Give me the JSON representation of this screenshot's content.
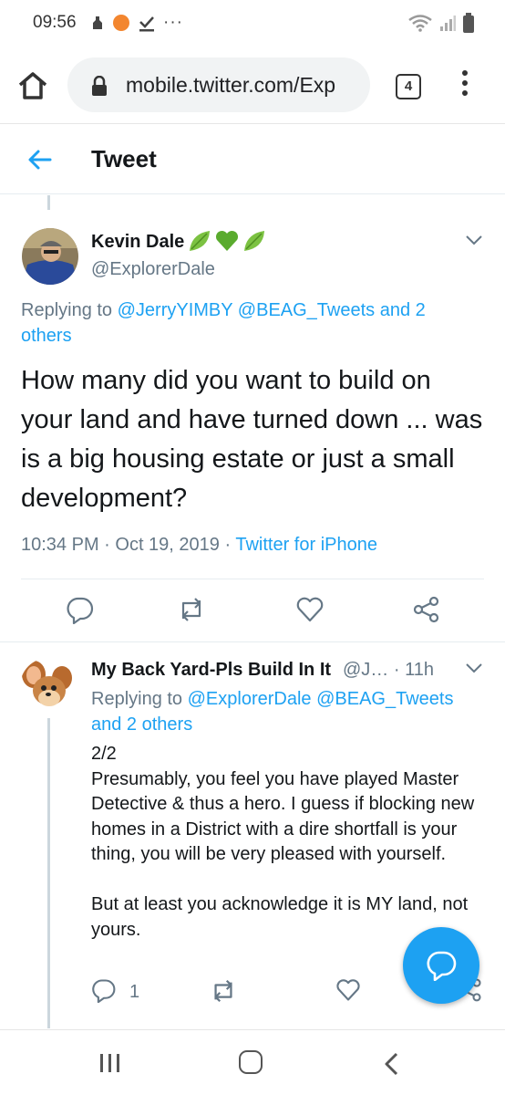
{
  "status_bar": {
    "time": "09:56",
    "notification_icons": [
      "notification-icon",
      "orange-dot-icon",
      "check-download-icon",
      "more-dots-icon"
    ],
    "more_dots": "···"
  },
  "browser": {
    "url": "mobile.twitter.com/Exp",
    "tab_count": "4"
  },
  "header": {
    "title": "Tweet"
  },
  "main_tweet": {
    "name": "Kevin Dale",
    "emojis": [
      "leaf-icon",
      "green-heart-icon",
      "leaf-icon"
    ],
    "handle": "@ExplorerDale",
    "replying_prefix": "Replying to ",
    "replying_links": "@JerryYIMBY @BEAG_Tweets and 2 others",
    "text": "How many did you want to build on your land and have turned down ... was is a big housing estate or just a small development?",
    "time": "10:34 PM",
    "date": "Oct 19, 2019",
    "sep": " · ",
    "source": "Twitter for iPhone"
  },
  "reply_tweet": {
    "name": "My Back Yard-Pls Build In It",
    "handle": "@J…",
    "age_sep": " · ",
    "age": "11h",
    "replying_prefix": "Replying to ",
    "replying_links": "@ExplorerDale @BEAG_Tweets and 2 others",
    "text": "2/2\nPresumably, you feel you have played Master Detective & thus a hero.  I guess if blocking new homes in a District with a dire shortfall is your thing, you will be very pleased with yourself.\n\nBut at least you acknowledge it is MY land, not yours.",
    "reply_count": "1"
  },
  "colors": {
    "twitter_blue": "#1da1f2",
    "secondary_text": "#657786",
    "divider": "#e6ecf0"
  }
}
